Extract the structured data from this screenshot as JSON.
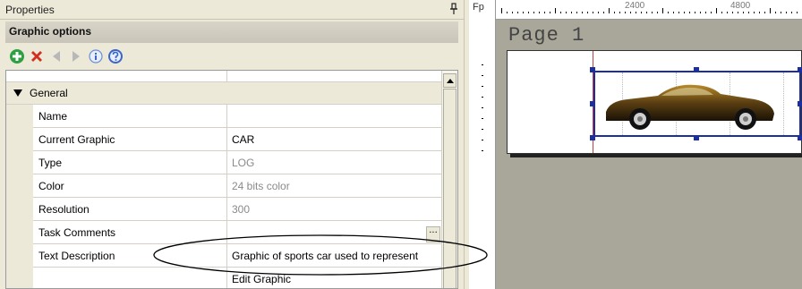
{
  "panel": {
    "title": "Properties",
    "pin_glyph": "ᵖ",
    "section_title": "Graphic options"
  },
  "toolbar": {
    "items": [
      {
        "name": "add-icon",
        "color": "#2ea043"
      },
      {
        "name": "delete-icon",
        "color": "#d03020"
      },
      {
        "name": "prev-icon",
        "color": "#b0b0b0"
      },
      {
        "name": "next-icon",
        "color": "#b0b0b0"
      },
      {
        "name": "info-icon",
        "color": "#6b8fd6"
      },
      {
        "name": "help-icon",
        "color": "#3a66c8"
      }
    ]
  },
  "grid": {
    "category": "General",
    "ellipsis": "...",
    "rows": [
      {
        "name": "Name",
        "value": "",
        "style": "dark"
      },
      {
        "name": "Current Graphic",
        "value": "CAR",
        "style": "dark"
      },
      {
        "name": "Type",
        "value": "LOG",
        "style": "grey"
      },
      {
        "name": "Color",
        "value": "24 bits color",
        "style": "grey"
      },
      {
        "name": "Resolution",
        "value": "300",
        "style": "grey"
      },
      {
        "name": "Task Comments",
        "value": "",
        "style": "dark"
      },
      {
        "name": "Text Description",
        "value": "Graphic of sports car used to represent",
        "style": "dark"
      },
      {
        "name": "",
        "value": "Edit Graphic",
        "style": "dark"
      }
    ]
  },
  "designer": {
    "ruler_label": "Fp",
    "ruler_marks": [
      "2400",
      "4800"
    ],
    "page_label": "Page 1"
  },
  "colors": {
    "selection": "#1c2fa0",
    "margin": "#c04040",
    "workspace": "#a9a79a"
  }
}
